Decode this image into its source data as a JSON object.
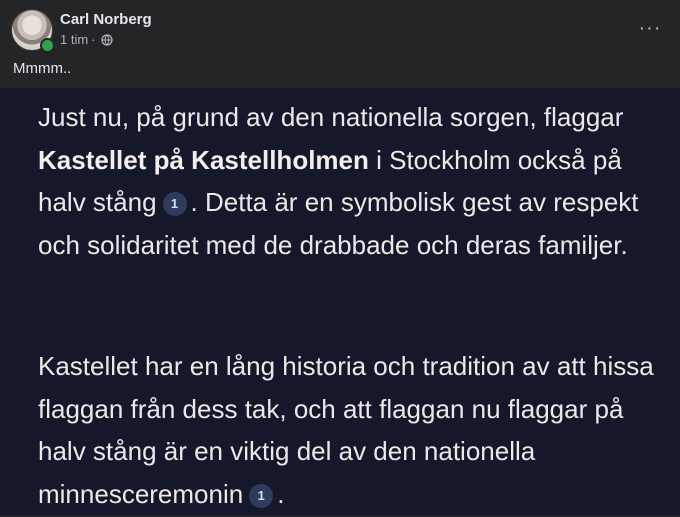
{
  "post": {
    "author": "Carl Norberg",
    "time": "1 tim",
    "separator": "·",
    "privacy_icon": "globe-icon",
    "more_label": "···",
    "text": "Mmmm.."
  },
  "image_text": {
    "p1_part1": "Just nu, på grund av den nationella sorgen, flaggar ",
    "p1_bold": "Kastellet på Kastellholmen",
    "p1_part2": " i Stockholm också på halv stång",
    "p1_cite": "1",
    "p1_part3": ". Detta är en symbolisk gest av respekt och solidaritet med de drabbade och deras familjer.",
    "p2_part1": "Kastellet har en lång historia och tradition av att hissa flaggan från dess tak, och att flaggan nu flaggar på halv stång är en viktig del av den nationella minnesceremonin",
    "p2_cite": "1",
    "p2_part2": "."
  },
  "colors": {
    "header_bg": "#242526",
    "image_bg": "#15182a",
    "online": "#31a24c",
    "citation_bg": "#2f3a5c"
  }
}
